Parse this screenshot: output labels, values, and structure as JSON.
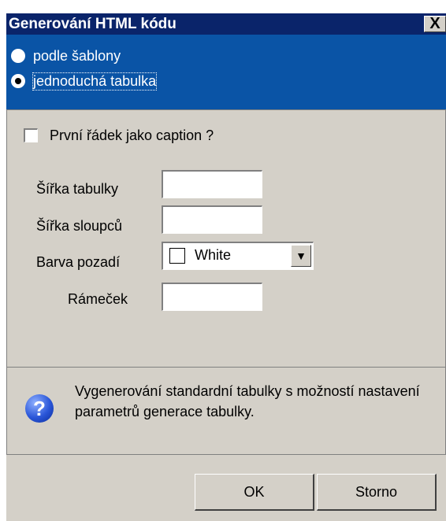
{
  "window": {
    "title": "Generování HTML kódu",
    "close_label": "X"
  },
  "mode": {
    "options": [
      {
        "label": "podle šablony",
        "selected": false
      },
      {
        "label": "jednoduchá tabulka",
        "selected": true
      }
    ]
  },
  "options": {
    "caption_checkbox": {
      "label": "První řádek jako caption ?",
      "checked": false
    },
    "table_width": {
      "label": "Šířka tabulky",
      "value": ""
    },
    "column_width": {
      "label": "Šířka sloupců",
      "value": ""
    },
    "background_color": {
      "label": "Barva pozadí",
      "value": "White",
      "swatch_color": "#ffffff"
    },
    "border": {
      "label": "Rámeček",
      "value": ""
    }
  },
  "info": {
    "icon": "help-icon",
    "text": "Vygenerování standardní tabulky s možností nastavení parametrů generace tabulky."
  },
  "buttons": {
    "ok_label": "OK",
    "cancel_label": "Storno"
  },
  "colors": {
    "titlebar": "#0a246a",
    "mode_panel": "#0a54a6",
    "dialog_face": "#d4d0c8"
  }
}
